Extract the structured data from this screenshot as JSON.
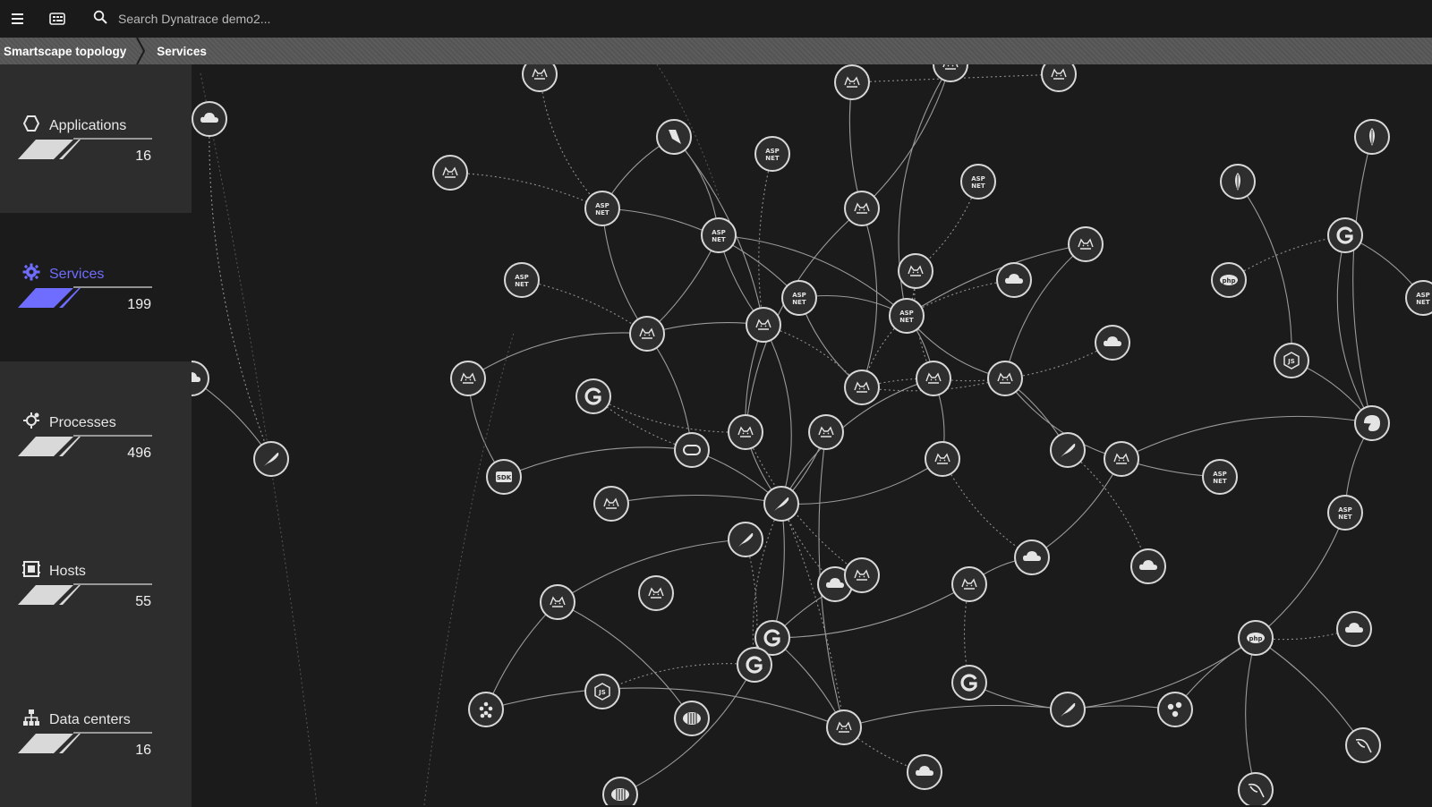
{
  "topbar": {
    "search_placeholder": "Search Dynatrace demo2...",
    "menu_icon": "hamburger-icon",
    "tiles_icon": "tiles-icon",
    "search_icon": "search-icon"
  },
  "breadcrumb": {
    "items": [
      "Smartscape topology",
      "Services"
    ]
  },
  "sidebar": {
    "items": [
      {
        "label": "Applications",
        "count": "16",
        "icon": "hexagon-icon",
        "active": false
      },
      {
        "label": "Services",
        "count": "199",
        "icon": "gear-icon",
        "active": true
      },
      {
        "label": "Processes",
        "count": "496",
        "icon": "process-icon",
        "active": false
      },
      {
        "label": "Hosts",
        "count": "55",
        "icon": "host-icon",
        "active": false
      },
      {
        "label": "Data centers",
        "count": "16",
        "icon": "datacenter-icon",
        "active": false
      }
    ]
  },
  "colors": {
    "accent": "#6f6dff",
    "background": "#1b1b1b",
    "sidebar_bg": "#2d2d2d",
    "node_stroke": "#d8d8d8",
    "edge": "#8a8a8a"
  },
  "topology": {
    "node_types": {
      "tomcat": "tomcat-icon",
      "aspnet": "aspnet-icon",
      "cloud": "cloud-icon",
      "feather": "apache-feather-icon",
      "glyph-g": "golang-icon",
      "php": "php-icon",
      "nodejs": "nodejs-icon",
      "mongodb": "mongodb-icon",
      "oracle": "oracle-icon",
      "sdk": "sdk-icon",
      "mysql": "mysql-icon",
      "redis": "redis-icon",
      "cassandra": "cassandra-icon",
      "kafka": "kafka-icon",
      "erlang": "erlang-icon",
      "netnode": "network-node-icon",
      "ruby": "ruby-icon"
    },
    "glyph_text": {
      "aspnet": "ASP.NET",
      "php": "php",
      "sdk": "SDK"
    }
  }
}
